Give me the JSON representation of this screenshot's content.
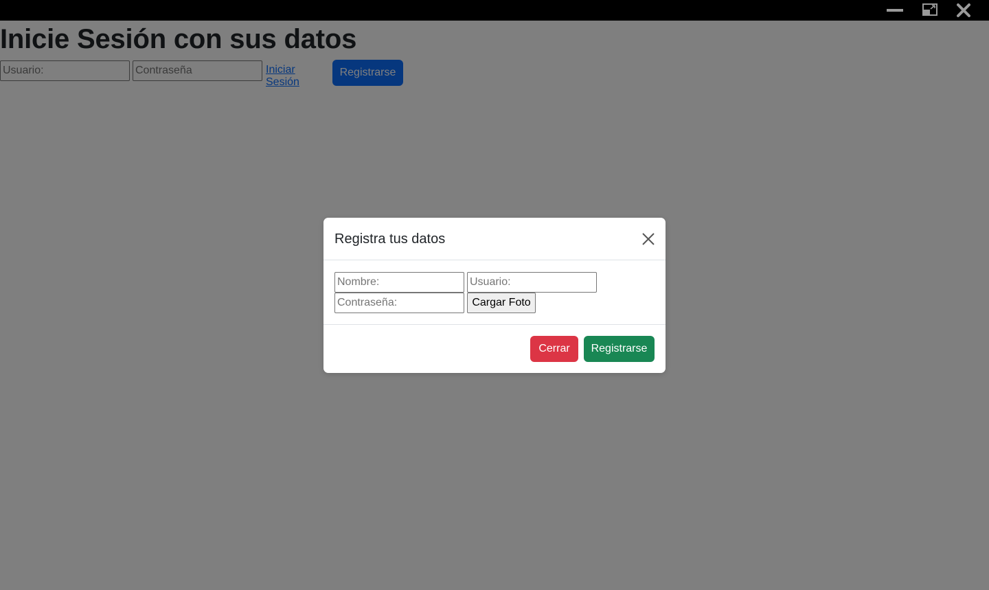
{
  "window_controls": {
    "minimize_icon": "minimize-icon",
    "maximize_icon": "restore-icon",
    "close_icon": "close-icon"
  },
  "page": {
    "title": "Inicie Sesión con sus datos",
    "login": {
      "user_placeholder": "Usuario:",
      "password_placeholder": "Contraseña",
      "login_link": "Iniciar Sesión",
      "register_button": "Registrarse"
    }
  },
  "modal": {
    "title": "Registra tus datos",
    "close_icon": "close-icon",
    "fields": {
      "name_placeholder": "Nombre:",
      "user_placeholder": "Usuario:",
      "password_placeholder": "Contraseña:"
    },
    "upload_button": "Cargar Foto",
    "footer": {
      "close_button": "Cerrar",
      "register_button": "Registrarse"
    }
  },
  "colors": {
    "primary": "#0d6efd",
    "danger": "#dc3545",
    "success": "#198754",
    "backdrop": "rgba(0,0,0,0.5)"
  }
}
